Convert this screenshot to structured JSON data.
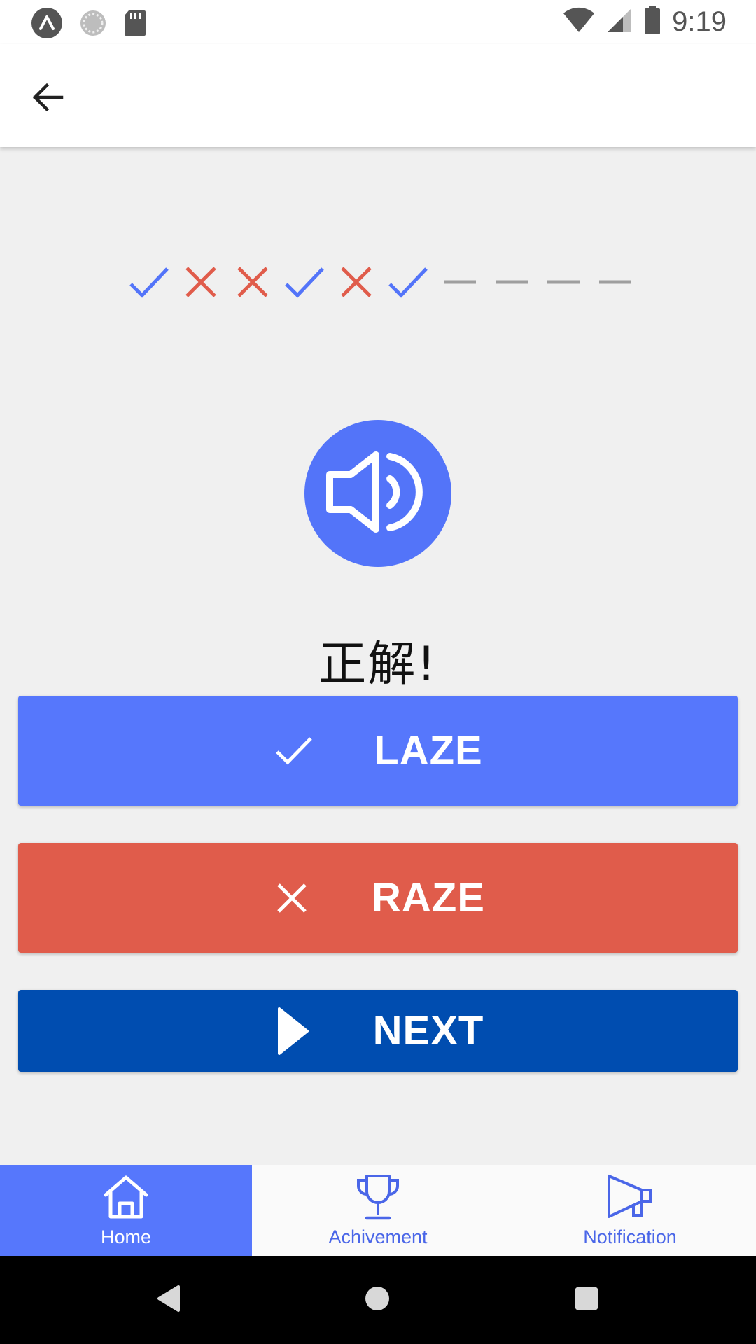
{
  "status_bar": {
    "time": "9:19",
    "icons": [
      "app-a-icon",
      "sync-circle-icon",
      "sd-card-icon",
      "wifi-icon",
      "signal-icon",
      "battery-icon"
    ]
  },
  "app_bar": {
    "back_icon": "arrow-back-icon"
  },
  "progress": {
    "marks": [
      "correct",
      "wrong",
      "wrong",
      "correct",
      "wrong",
      "correct",
      "pending",
      "pending",
      "pending",
      "pending"
    ],
    "colors": {
      "correct": "#5374f9",
      "wrong": "#e05c4b",
      "pending": "#9e9e9e"
    }
  },
  "speaker": {
    "icon": "speaker-icon",
    "color": "#5374f9"
  },
  "result": {
    "text": "正解!"
  },
  "buttons": {
    "laze": {
      "label": "LAZE",
      "icon": "check-icon",
      "color": "#5677fc"
    },
    "raze": {
      "label": "RAZE",
      "icon": "close-icon",
      "color": "#e05c4b"
    },
    "next": {
      "label": "NEXT",
      "icon": "play-icon",
      "color": "#004db0"
    }
  },
  "bottom_nav": {
    "items": [
      {
        "label": "Home",
        "icon": "home-icon",
        "active": true
      },
      {
        "label": "Achivement",
        "icon": "trophy-icon",
        "active": false
      },
      {
        "label": "Notification",
        "icon": "megaphone-icon",
        "active": false
      }
    ],
    "accent": "#5677fc"
  },
  "system_nav": {
    "icons": [
      "back-triangle-icon",
      "home-circle-icon",
      "recents-square-icon"
    ]
  }
}
